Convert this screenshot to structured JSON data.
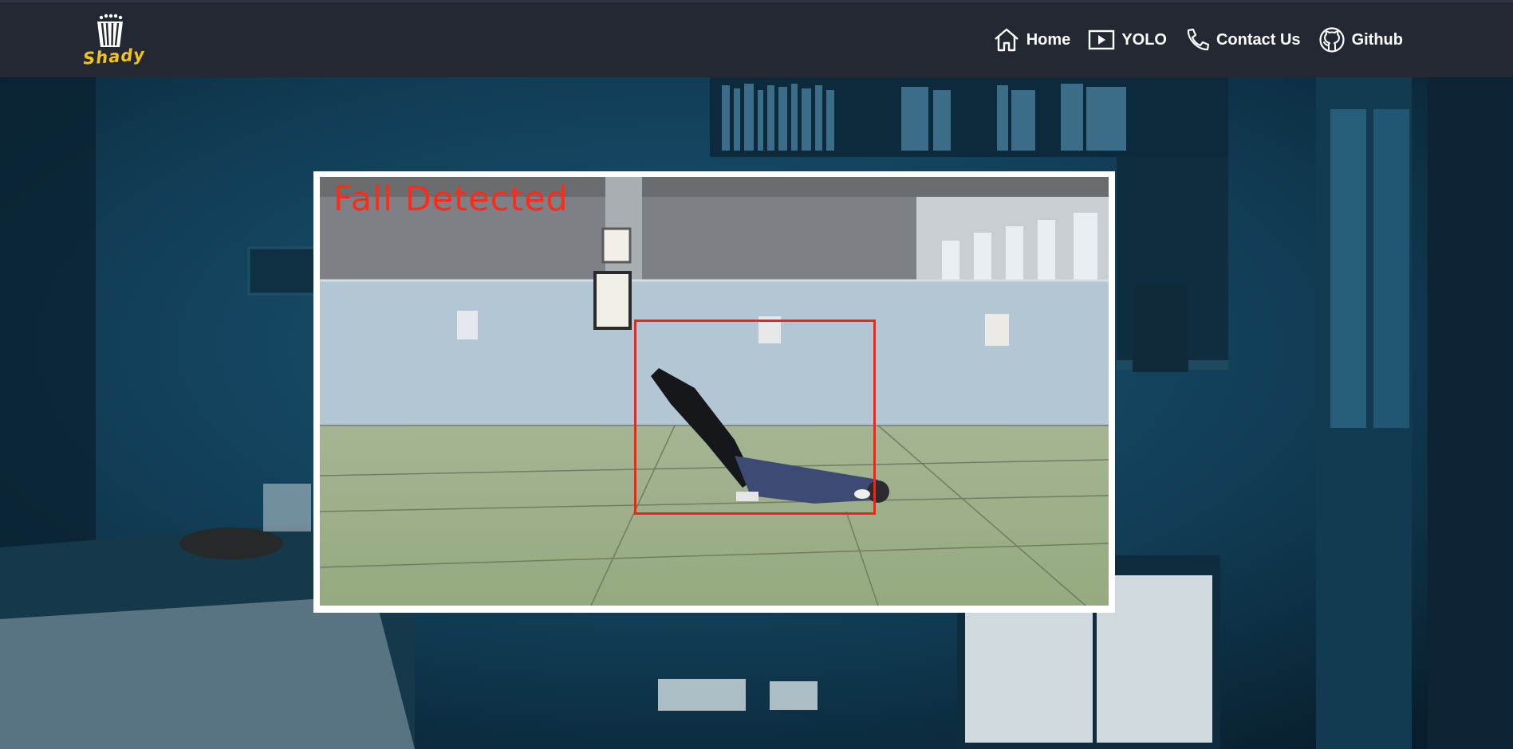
{
  "brand": {
    "name": "Shady"
  },
  "nav": {
    "items": [
      {
        "label": "Home",
        "icon": "home-icon"
      },
      {
        "label": "YOLO",
        "icon": "play-icon"
      },
      {
        "label": "Contact Us",
        "icon": "phone-icon"
      },
      {
        "label": "Github",
        "icon": "github-icon"
      }
    ]
  },
  "video": {
    "overlay_label": "Fall Detected",
    "detection_box_color": "#ff1e12"
  },
  "colors": {
    "navbar": "#232833",
    "background": "#0c2738",
    "brand_accent": "#f2c31c",
    "detection": "#ff2a1a"
  }
}
